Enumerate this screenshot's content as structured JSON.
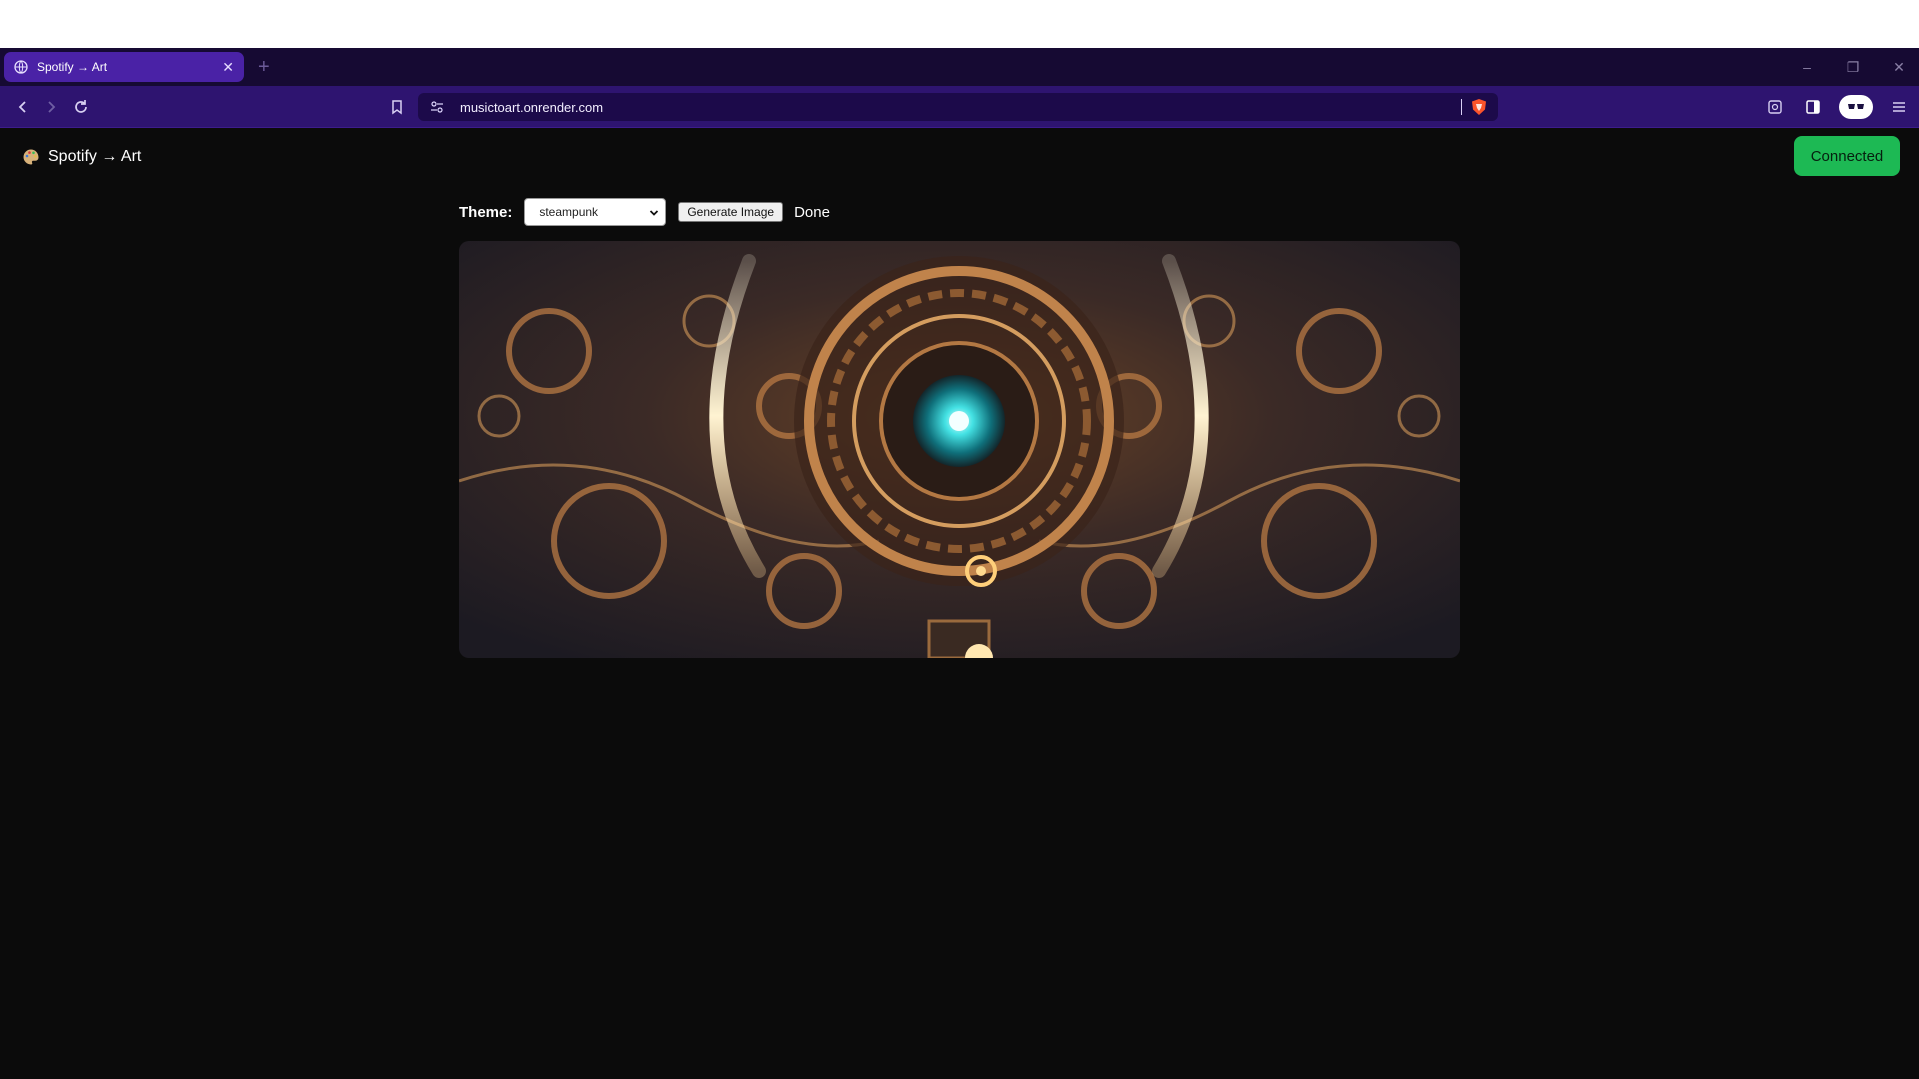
{
  "browser": {
    "tab_title": "Spotify → Art",
    "tab_close": "✕",
    "new_tab": "+",
    "url": "musictoart.onrender.com",
    "window_controls": {
      "minimize": "–",
      "restore": "❐",
      "close": "✕"
    }
  },
  "header": {
    "brand": "Spotify → Art",
    "connected_label": "Connected"
  },
  "controls": {
    "theme_label": "Theme:",
    "theme_selected": "steampunk",
    "generate_label": "Generate Image",
    "status": "Done"
  },
  "colors": {
    "chrome_dark": "#160a33",
    "chrome_toolbar": "#2e1470",
    "tab_active": "#4a22a6",
    "page_bg": "#0b0b0b",
    "accent_green": "#1db954"
  },
  "icons": [
    "globe-icon",
    "back-icon",
    "forward-icon",
    "reload-icon",
    "bookmark-icon",
    "site-settings-icon",
    "brave-shield-icon",
    "tab-search-icon",
    "sidebar-icon",
    "wallet-extension-icon",
    "menu-icon",
    "palette-icon"
  ]
}
